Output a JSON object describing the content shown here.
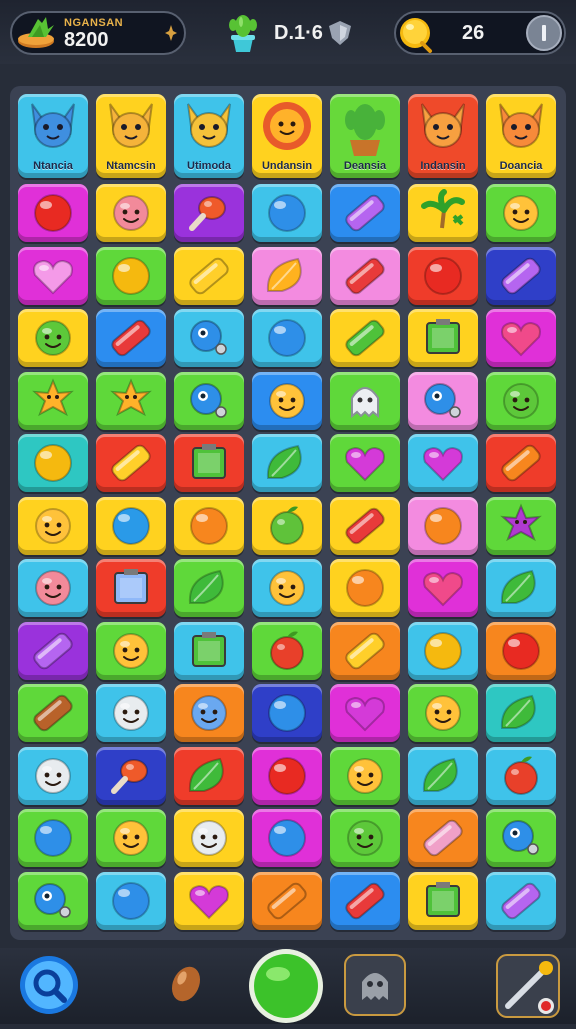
{
  "header": {
    "score_label": "NGANSAN",
    "score_value": "8200",
    "center_value": "D.1·6",
    "coins": "26"
  },
  "characters": [
    {
      "label": "Ntancia",
      "color": "#3fc3ea",
      "icon": "blue-cat-icon"
    },
    {
      "label": "Ntamcsin",
      "color": "#ffd21f",
      "icon": "yellow-elf-icon"
    },
    {
      "label": "Utimoda",
      "color": "#3fc3ea",
      "icon": "yellow-imp-icon"
    },
    {
      "label": "Undansin",
      "color": "#ffd21f",
      "icon": "sun-face-icon"
    },
    {
      "label": "Deansia",
      "color": "#67d93a",
      "icon": "cactus-icon"
    },
    {
      "label": "Indansin",
      "color": "#ef4a2a",
      "icon": "orange-fox-icon"
    },
    {
      "label": "Doancia",
      "color": "#ffd21f",
      "icon": "orange-devil-icon"
    }
  ],
  "colors": {
    "M": "#e030d8",
    "Y": "#ffd21f",
    "V": "#9a32dc",
    "C": "#3fc3ea",
    "B": "#2c8df0",
    "G": "#5fd83a",
    "D": "#2f3fc8",
    "P": "#f38be0",
    "R": "#ef3c2a",
    "O": "#f7861e",
    "T": "#2ec7c2"
  },
  "grid": [
    [
      "M:red-ball-icon",
      "Y:pink-face-icon",
      "V:drumstick-icon",
      "C:blue-ball-icon",
      "B:purple-candy-icon",
      "Y:palm-tree-icon",
      "G:smiley-icon"
    ],
    [
      "M:heart-icon",
      "G:yellow-ball-icon",
      "Y:yellow-candy-icon",
      "P:yellow-leaf-icon",
      "P:red-candy-icon",
      "R:red-ball-icon",
      "D:purple-candy-icon"
    ],
    [
      "Y:green-face-icon",
      "B:red-candy-icon",
      "C:blue-fish-icon",
      "C:blue-ball-icon",
      "Y:green-candy-icon",
      "Y:green-box-icon",
      "M:pink-heart-icon"
    ],
    [
      "G:star-face-icon",
      "G:star-face-icon",
      "G:blue-fish-icon",
      "B:smiley-icon",
      "G:white-ghost-icon",
      "P:blue-fish-icon",
      "G:green-face-icon"
    ],
    [
      "T:yellow-ball-icon",
      "R:yellow-candy-icon",
      "R:green-box-icon",
      "C:green-leaf-icon",
      "G:purple-heart-icon",
      "C:purple-heart-icon",
      "R:orange-candy-icon"
    ],
    [
      "Y:smiley-icon",
      "Y:blue-drop-icon",
      "Y:orange-ball-icon",
      "Y:green-apple-icon",
      "Y:red-candy-icon",
      "P:orange-ball-icon",
      "G:purple-star-icon"
    ],
    [
      "C:pink-face-icon",
      "R:blue-box-icon",
      "G:green-leaf-icon",
      "C:smiley-icon",
      "Y:orange-ball-icon",
      "M:pink-heart-icon",
      "C:green-leaf-icon"
    ],
    [
      "V:purple-candy-icon",
      "G:smiley-icon",
      "C:green-box-icon",
      "G:red-apple-icon",
      "O:yellow-candy-icon",
      "C:yellow-ball-icon",
      "O:red-ball-icon"
    ],
    [
      "G:brown-candy-icon",
      "C:white-face-icon",
      "O:blue-face-icon",
      "D:blue-ball-icon",
      "M:purple-heart-icon",
      "G:smiley-icon",
      "T:green-leaf-icon"
    ],
    [
      "C:white-face-icon",
      "D:drumstick-icon",
      "R:green-leaf-icon",
      "M:red-ball-icon",
      "G:smiley-icon",
      "C:green-leaf-icon",
      "C:red-apple-icon"
    ],
    [
      "G:blue-ball-icon",
      "G:smiley-icon",
      "Y:white-face-icon",
      "M:blue-ball-icon",
      "G:green-face-icon",
      "O:pink-candy-icon",
      "G:blue-fish-icon"
    ],
    [
      "G:blue-fish-icon",
      "C:blue-ball-icon",
      "Y:purple-heart-icon",
      "O:orange-candy-icon",
      "B:red-candy-icon",
      "Y:green-box-icon",
      "C:purple-candy-icon"
    ]
  ],
  "bottom": {
    "search": "search-icon",
    "seed": "seed-icon",
    "go": "green-orb-button",
    "ghost": "ghost-icon",
    "wand": "magic-wand-icon"
  }
}
